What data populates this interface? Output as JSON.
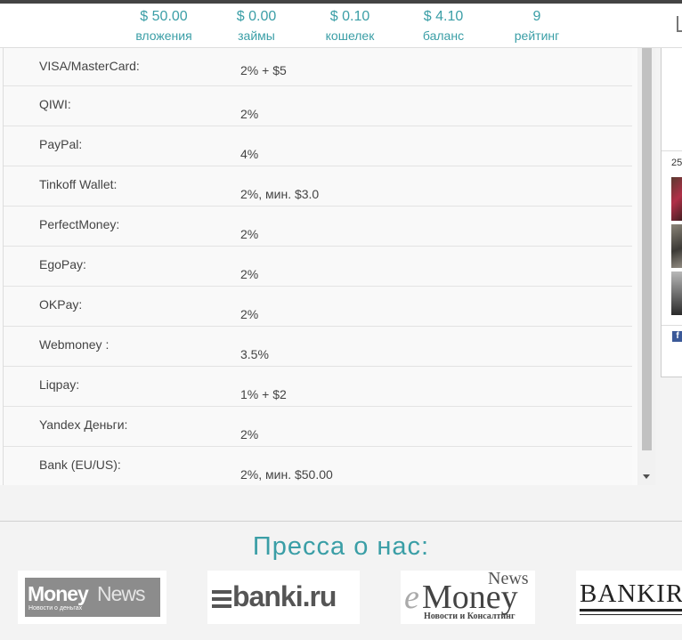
{
  "stats": [
    {
      "value": "$ 50.00",
      "label": "вложения"
    },
    {
      "value": "$ 0.00",
      "label": "займы"
    },
    {
      "value": "$ 0.10",
      "label": "кошелек"
    },
    {
      "value": "$ 4.10",
      "label": "баланс"
    },
    {
      "value": "9",
      "label": "рейтинг"
    }
  ],
  "fees": [
    {
      "method": "VISA/MasterCard:",
      "fee": "2% + $5"
    },
    {
      "method": "QIWI:",
      "fee": "2%"
    },
    {
      "method": "PayPal:",
      "fee": "4%"
    },
    {
      "method": "Tinkoff Wallet:",
      "fee": "2%, мин. $3.0"
    },
    {
      "method": "PerfectMoney:",
      "fee": "2%"
    },
    {
      "method": "EgoPay:",
      "fee": "2%"
    },
    {
      "method": "OKPay:",
      "fee": "2%"
    },
    {
      "method": "Webmoney :",
      "fee": "3.5%"
    },
    {
      "method": "Liqpay:",
      "fee": "1% + $2"
    },
    {
      "method": "Yandex Деньги:",
      "fee": "2%"
    },
    {
      "method": "Bank (EU/US):",
      "fee": "2%, мин. $50.00"
    }
  ],
  "sidebar": {
    "count": "25"
  },
  "press": {
    "title": "Пресса о нас:",
    "logos": {
      "moneynews": {
        "word1": "Money",
        "word2": "News",
        "tagline": "Новости о деньгах"
      },
      "banki": {
        "text": "banki.ru"
      },
      "emoney": {
        "e": "e",
        "money": "Money",
        "news": "News",
        "tagline": "Новости и Консалтинг"
      },
      "bankir": {
        "text": "BANKIR."
      }
    }
  },
  "colors": {
    "accent": "#3a9ea6"
  }
}
